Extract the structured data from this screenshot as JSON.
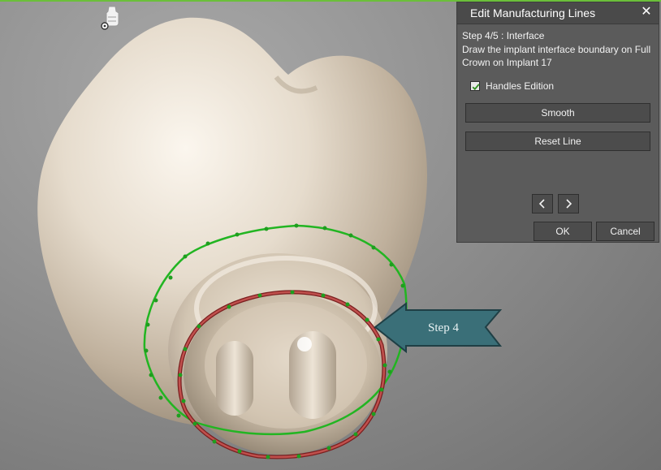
{
  "panel": {
    "title": "Edit Manufacturing Lines",
    "close_glyph": "✕",
    "step_title": "Step 4/5 : Interface",
    "step_description": "Draw the implant interface boundary on Full Crown on Implant 17",
    "handles_edition": {
      "label": "Handles Edition",
      "checked": true
    },
    "smooth_label": "Smooth",
    "reset_line_label": "Reset Line",
    "prev_icon": "chevron-left-icon",
    "next_icon": "chevron-right-icon",
    "ok_label": "OK",
    "cancel_label": "Cancel"
  },
  "viewport": {
    "step_callout_label": "Step 4",
    "abutment_icon": "abutment-icon",
    "colors": {
      "crown": "#e6dccd",
      "outer_line": "#22b522",
      "inner_line": "#c0504d",
      "handle": "#1e9e1e",
      "callout": "#3a6f78",
      "panel_bg": "#5b5b5b"
    }
  }
}
